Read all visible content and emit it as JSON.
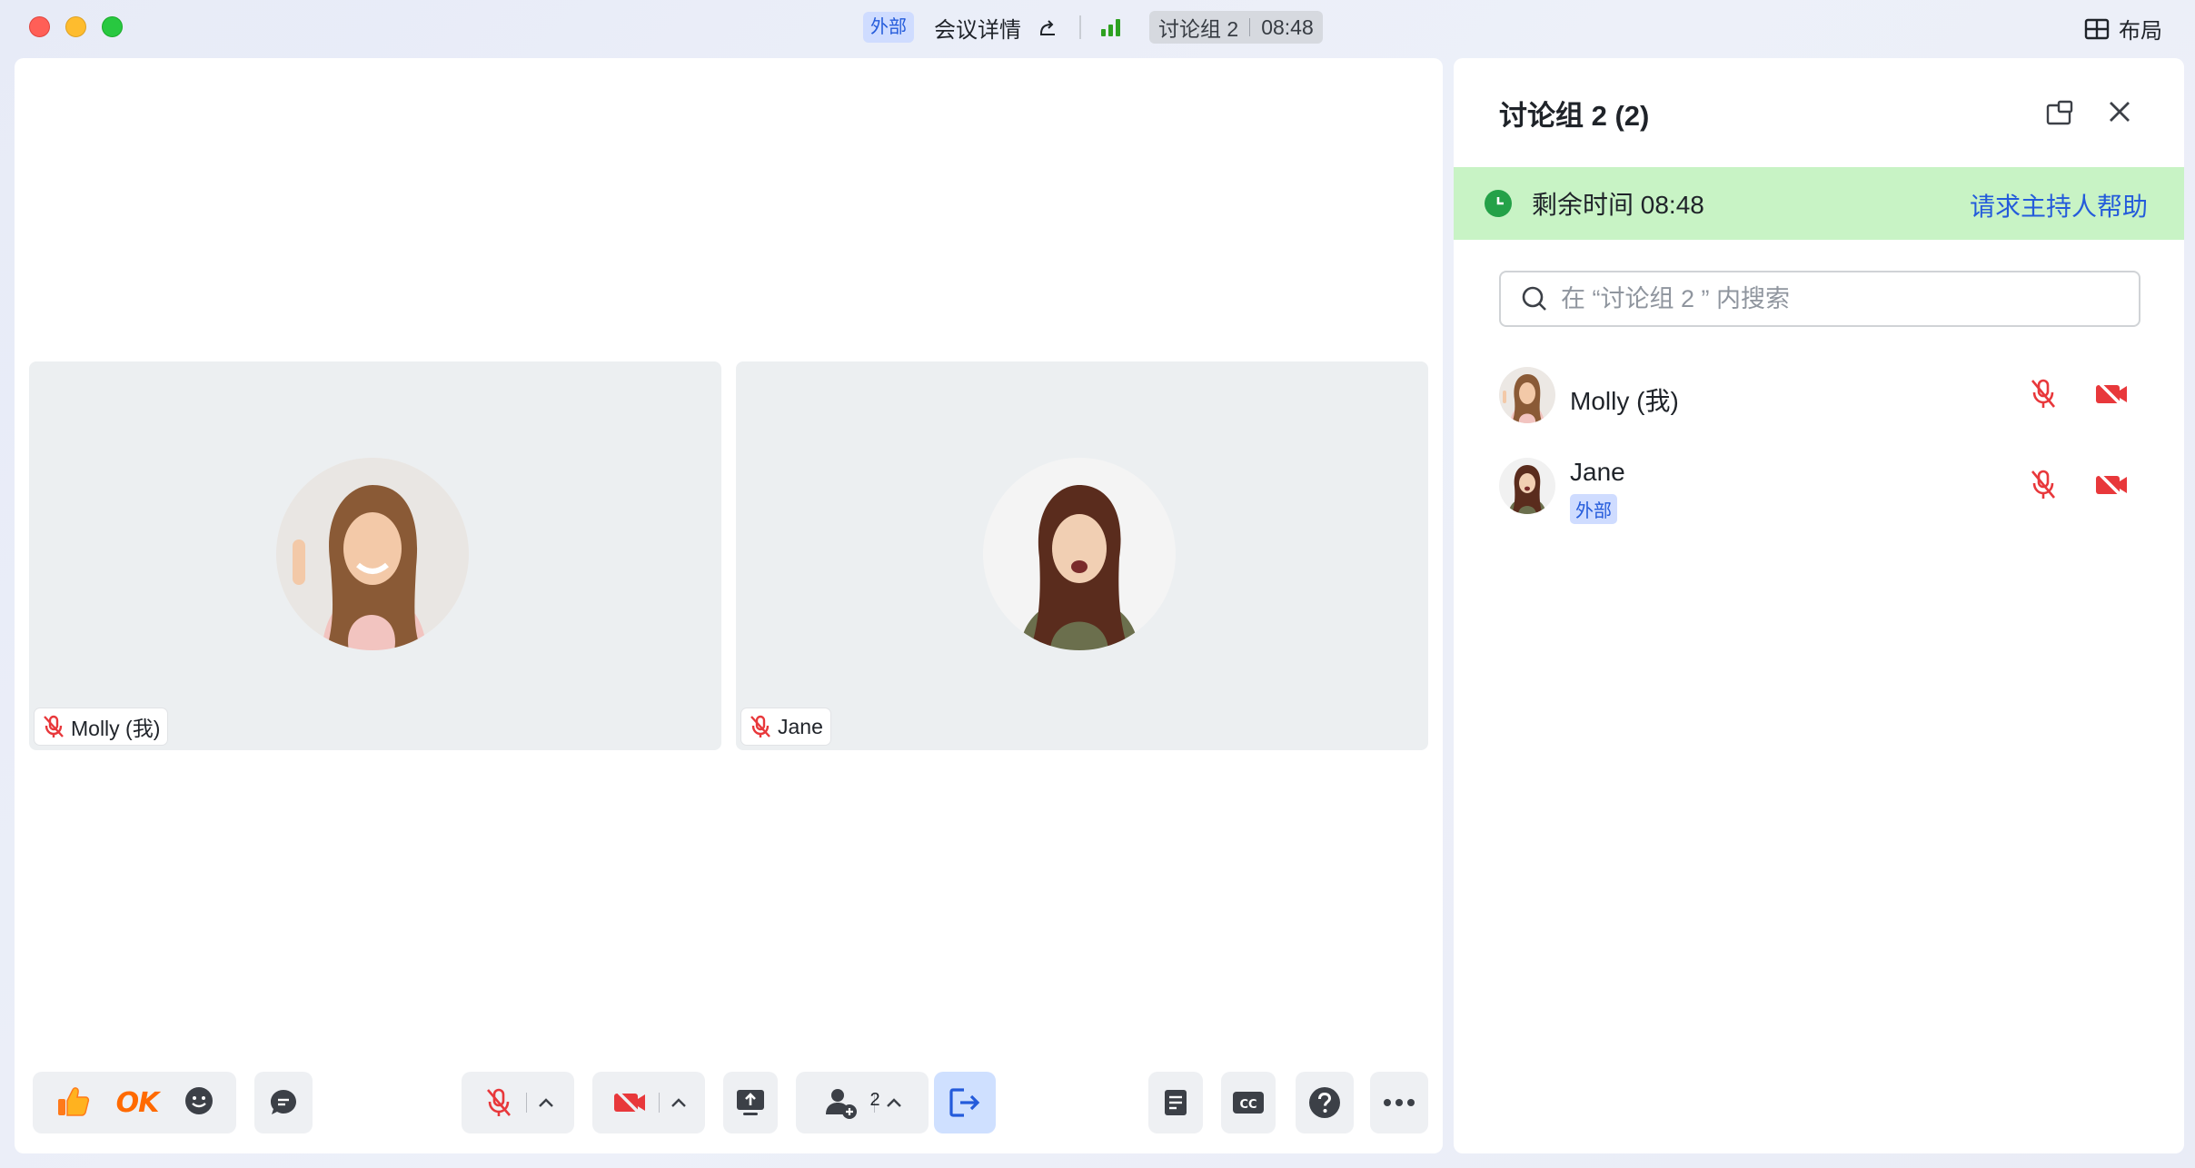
{
  "titlebar": {
    "external_badge": "外部",
    "meeting_details": "会议详情",
    "group_name": "讨论组 2",
    "timer": "08:48",
    "layout_label": "布局"
  },
  "participants": [
    {
      "name": "Molly (我)",
      "external": false,
      "muted": true,
      "camera_off": true
    },
    {
      "name": "Jane",
      "external": true,
      "muted": true,
      "camera_off": true
    }
  ],
  "panel": {
    "title": "讨论组 2 (2)",
    "remaining_label": "剩余时间 08:48",
    "help_link": "请求主持人帮助",
    "search_placeholder": "在 “讨论组 2 ” 内搜索",
    "external_badge": "外部"
  },
  "toolbar": {
    "ok_label": "OK",
    "people_count": "2"
  },
  "colors": {
    "accent_blue": "#245bdb",
    "muted_red": "#e8383b",
    "timer_green_bg": "#c8f3c5",
    "timer_green_icon": "#24a148",
    "reaction_orange": "#ff6a00"
  },
  "icons": [
    "thumbs-up-icon",
    "smile-icon",
    "chat-icon",
    "mic-off-icon",
    "camera-off-icon",
    "share-screen-icon",
    "add-person-icon",
    "leave-icon",
    "notes-icon",
    "cc-icon",
    "help-icon",
    "more-icon",
    "search-icon",
    "popout-icon",
    "close-icon",
    "clock-icon",
    "layout-grid-icon",
    "share-icon",
    "signal-icon"
  ]
}
